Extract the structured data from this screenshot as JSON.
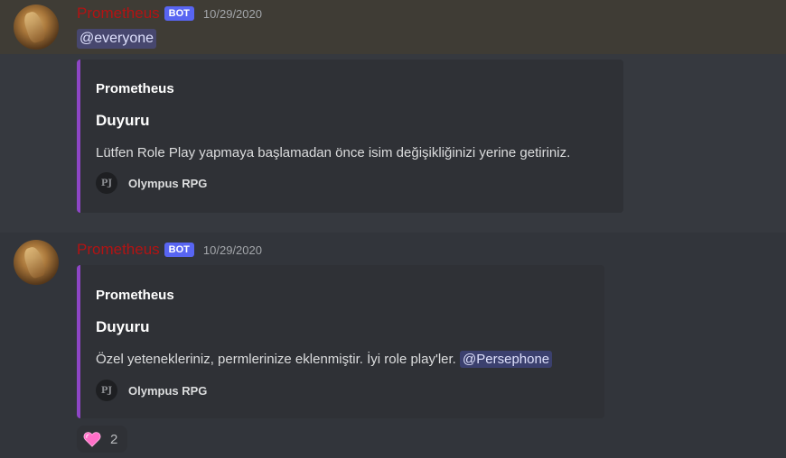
{
  "messages": [
    {
      "username": "Prometheus",
      "tag": "BOT",
      "timestamp": "10/29/2020",
      "mention": "@everyone",
      "embed": {
        "author": "Prometheus",
        "title": "Duyuru",
        "description": "Lütfen Role Play yapmaya başlamadan önce isim değişikliğinizi yerine getiriniz.",
        "footer_icon_text": "PJ",
        "footer_text": "Olympus RPG"
      }
    },
    {
      "username": "Prometheus",
      "tag": "BOT",
      "timestamp": "10/29/2020",
      "embed": {
        "author": "Prometheus",
        "title": "Duyuru",
        "description": "Özel yetenekleriniz, permlerinize eklenmiştir. İyi role play'ler.",
        "mention": "@Persephone",
        "footer_icon_text": "PJ",
        "footer_text": "Olympus RPG"
      },
      "reaction": {
        "icon": "heart-icon",
        "count": "2"
      }
    }
  ],
  "colors": {
    "username": "#b31313",
    "bot_tag": "#5865f2",
    "embed_border": "#8e46c6",
    "heart": "#ff6fc8"
  }
}
